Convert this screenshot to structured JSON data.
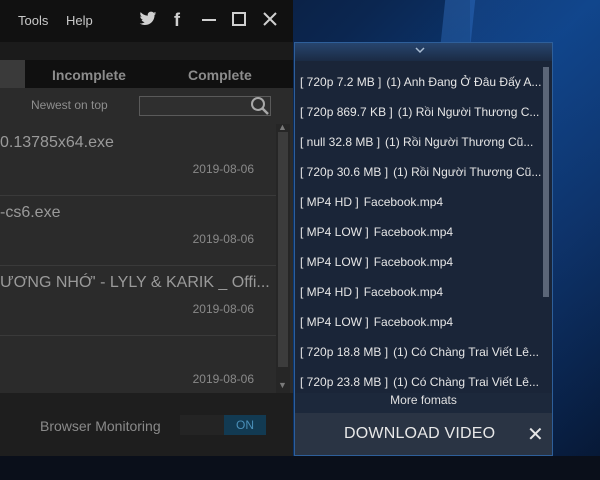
{
  "app": {
    "menu": {
      "tools": "Tools",
      "help": "Help"
    },
    "icons": {
      "twitter": "twitter-icon",
      "facebook": "facebook-icon",
      "minimize": "minimize-icon",
      "maximize": "maximize-icon",
      "close": "close-icon"
    },
    "tabs": {
      "incomplete": "Incomplete",
      "complete": "Complete"
    },
    "sort_label": "Newest on top",
    "search": {
      "placeholder": ""
    },
    "rows": [
      {
        "name": "0.13785x64.exe",
        "date": "2019-08-06"
      },
      {
        "name": "-cs6.exe",
        "date": "2019-08-06"
      },
      {
        "name": "ƯƠNG NHỚ' - LYLY & KARIK _ Offi...",
        "date": "2019-08-06"
      },
      {
        "name": "",
        "date": "2019-08-06"
      }
    ],
    "browser_monitoring": {
      "label": "Browser Monitoring",
      "state": "ON"
    }
  },
  "panel": {
    "formats": [
      {
        "tag": "[ 720p 7.2 MB ]",
        "title": "(1) Anh Đang Ở Đâu Đấy A..."
      },
      {
        "tag": "[ 720p 869.7 KB ]",
        "title": "(1) Rồi Người Thương C..."
      },
      {
        "tag": "[ null 32.8 MB ]",
        "title": "(1) Rồi Người Thương Cũ..."
      },
      {
        "tag": "[ 720p 30.6 MB ]",
        "title": "(1) Rồi Người Thương Cũ..."
      },
      {
        "tag": "[ MP4 HD ]",
        "title": "Facebook.mp4"
      },
      {
        "tag": "[ MP4 LOW ]",
        "title": "Facebook.mp4"
      },
      {
        "tag": "[ MP4 LOW ]",
        "title": "Facebook.mp4"
      },
      {
        "tag": "[ MP4 HD ]",
        "title": "Facebook.mp4"
      },
      {
        "tag": "[ MP4 LOW ]",
        "title": "Facebook.mp4"
      },
      {
        "tag": "[ 720p 18.8 MB ]",
        "title": "(1) Có Chàng Trai Viết Lê..."
      },
      {
        "tag": "[ 720p 23.8 MB ]",
        "title": "(1) Có Chàng Trai Viết Lê..."
      }
    ],
    "more_formats": "More fomats",
    "download_label": "DOWNLOAD VIDEO",
    "close_symbol": "✕"
  },
  "colors": {
    "accent": "#2e5f9a",
    "toggle_on": "#4a8fb8"
  }
}
